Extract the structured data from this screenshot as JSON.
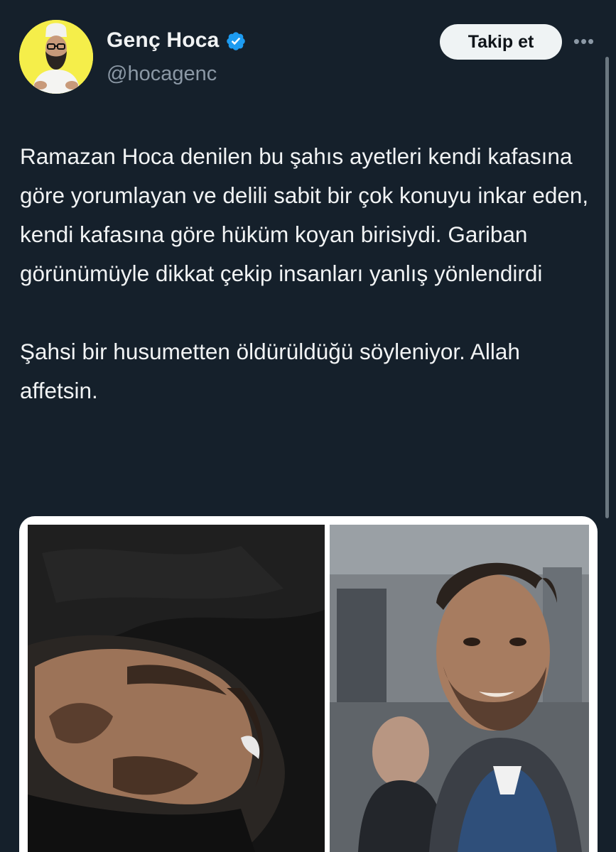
{
  "author": {
    "display_name": "Genç Hoca",
    "handle": "@hocagenc",
    "verified": true,
    "avatar_bg": "#f5ee4a"
  },
  "actions": {
    "follow_label": "Takip et",
    "more_icon": "more-horizontal-icon"
  },
  "tweet": {
    "paragraph1": "Ramazan Hoca denilen bu şahıs ayetleri kendi kafasına göre yorumlayan ve delili sabit bir çok konuyu inkar eden, kendi kafasına göre hüküm koyan birisiydi. Gariban görünümüyle dikkat çekip insanları yanlış yönlendirdi",
    "paragraph2": "Şahsi bir husumetten öldürüldüğü söyleniyor. Allah affetsin."
  },
  "colors": {
    "background": "#15202b",
    "text": "#f1f3f4",
    "secondary_text": "#8b98a5",
    "verified": "#1d9bf0"
  }
}
